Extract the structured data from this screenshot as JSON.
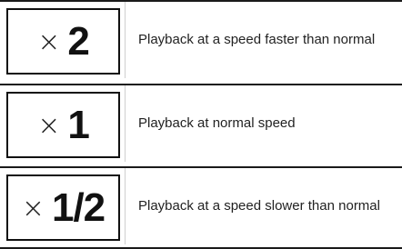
{
  "rows": [
    {
      "multiplier_symbol": "×",
      "speed": "2",
      "description": "Playback at a speed faster than normal"
    },
    {
      "multiplier_symbol": "×",
      "speed": "1",
      "description": "Playback at normal speed"
    },
    {
      "multiplier_symbol": "×",
      "speed": "1/2",
      "description": "Playback at a speed slower than normal"
    }
  ]
}
